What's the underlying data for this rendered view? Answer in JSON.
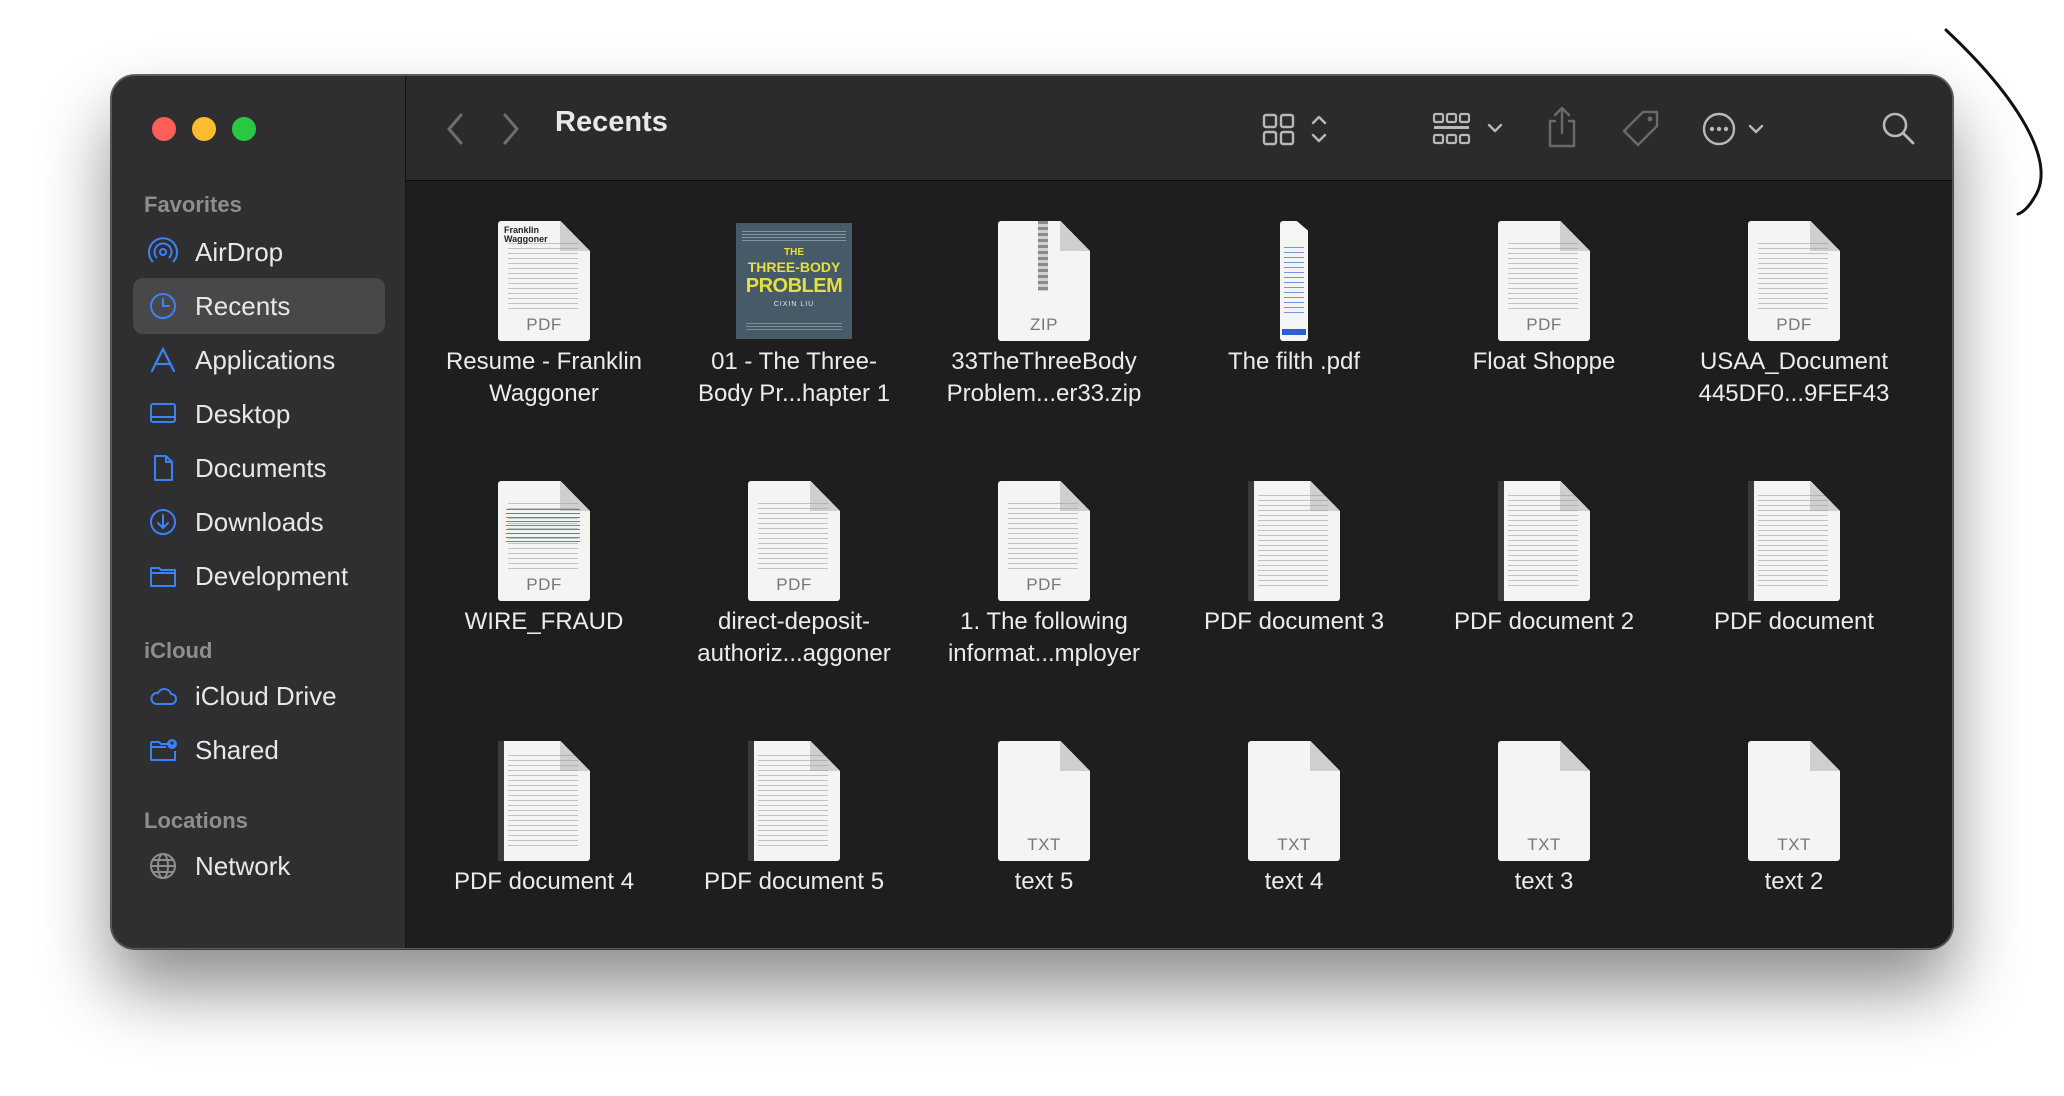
{
  "window": {
    "title": "Recents"
  },
  "sidebar": {
    "sections": [
      {
        "title": "Favorites",
        "items": [
          {
            "label": "AirDrop",
            "icon": "airdrop-icon",
            "active": false
          },
          {
            "label": "Recents",
            "icon": "clock-icon",
            "active": true
          },
          {
            "label": "Applications",
            "icon": "applications-icon",
            "active": false
          },
          {
            "label": "Desktop",
            "icon": "desktop-icon",
            "active": false
          },
          {
            "label": "Documents",
            "icon": "document-icon",
            "active": false
          },
          {
            "label": "Downloads",
            "icon": "download-icon",
            "active": false
          },
          {
            "label": "Development",
            "icon": "folder-icon",
            "active": false
          }
        ]
      },
      {
        "title": "iCloud",
        "items": [
          {
            "label": "iCloud Drive",
            "icon": "cloud-icon",
            "active": false
          },
          {
            "label": "Shared",
            "icon": "shared-folder-icon",
            "active": false
          }
        ]
      },
      {
        "title": "Locations",
        "items": [
          {
            "label": "Network",
            "icon": "globe-icon",
            "active": false
          }
        ]
      }
    ]
  },
  "toolbar": {
    "back_icon": "chevron-left-icon",
    "forward_icon": "chevron-right-icon",
    "view_icon": "grid-view-icon",
    "group_icon": "group-by-icon",
    "share_icon": "share-icon",
    "tag_icon": "tag-icon",
    "more_icon": "ellipsis-circle-icon",
    "search_icon": "search-icon"
  },
  "files": [
    {
      "line1": "Resume - Franklin",
      "line2": "Waggoner",
      "kind": "pdf",
      "ext": "PDF",
      "preview_header": "Franklin Waggoner"
    },
    {
      "line1": "01 - The Three-",
      "line2": "Body Pr...hapter 1",
      "kind": "book",
      "cover_line1": "THE",
      "cover_line2": "THREE-BODY",
      "cover_line3": "PROBLEM",
      "cover_author": "CIXIN LIU"
    },
    {
      "line1": "33TheThreeBody",
      "line2": "Problem...er33.zip",
      "kind": "zip",
      "ext": "ZIP"
    },
    {
      "line1": "The filth .pdf",
      "line2": "",
      "kind": "narrow"
    },
    {
      "line1": "Float Shoppe",
      "line2": "",
      "kind": "pdf",
      "ext": "PDF"
    },
    {
      "line1": "USAA_Document",
      "line2": "445DF0...9FEF43",
      "kind": "pdf",
      "ext": "PDF"
    },
    {
      "line1": "WIRE_FRAUD",
      "line2": "",
      "kind": "pdf-red",
      "ext": "PDF"
    },
    {
      "line1": "direct-deposit-",
      "line2": "authoriz...aggoner",
      "kind": "pdf",
      "ext": "PDF"
    },
    {
      "line1": "1. The following",
      "line2": "informat...mployer",
      "kind": "pdf",
      "ext": "PDF"
    },
    {
      "line1": "PDF document 3",
      "line2": "",
      "kind": "pdf-spine"
    },
    {
      "line1": "PDF document 2",
      "line2": "",
      "kind": "pdf-spine"
    },
    {
      "line1": "PDF document",
      "line2": "",
      "kind": "pdf-spine"
    },
    {
      "line1": "PDF document 4",
      "line2": "",
      "kind": "pdf-spine"
    },
    {
      "line1": "PDF document 5",
      "line2": "",
      "kind": "pdf-spine"
    },
    {
      "line1": "text 5",
      "line2": "",
      "kind": "txt",
      "ext": "TXT"
    },
    {
      "line1": "text 4",
      "line2": "",
      "kind": "txt",
      "ext": "TXT"
    },
    {
      "line1": "text 3",
      "line2": "",
      "kind": "txt",
      "ext": "TXT"
    },
    {
      "line1": "text 2",
      "line2": "",
      "kind": "txt",
      "ext": "TXT"
    }
  ],
  "colors": {
    "accent": "#3b82f6",
    "close": "#ff5f57",
    "minimize": "#febc2e",
    "maximize": "#28c840"
  }
}
